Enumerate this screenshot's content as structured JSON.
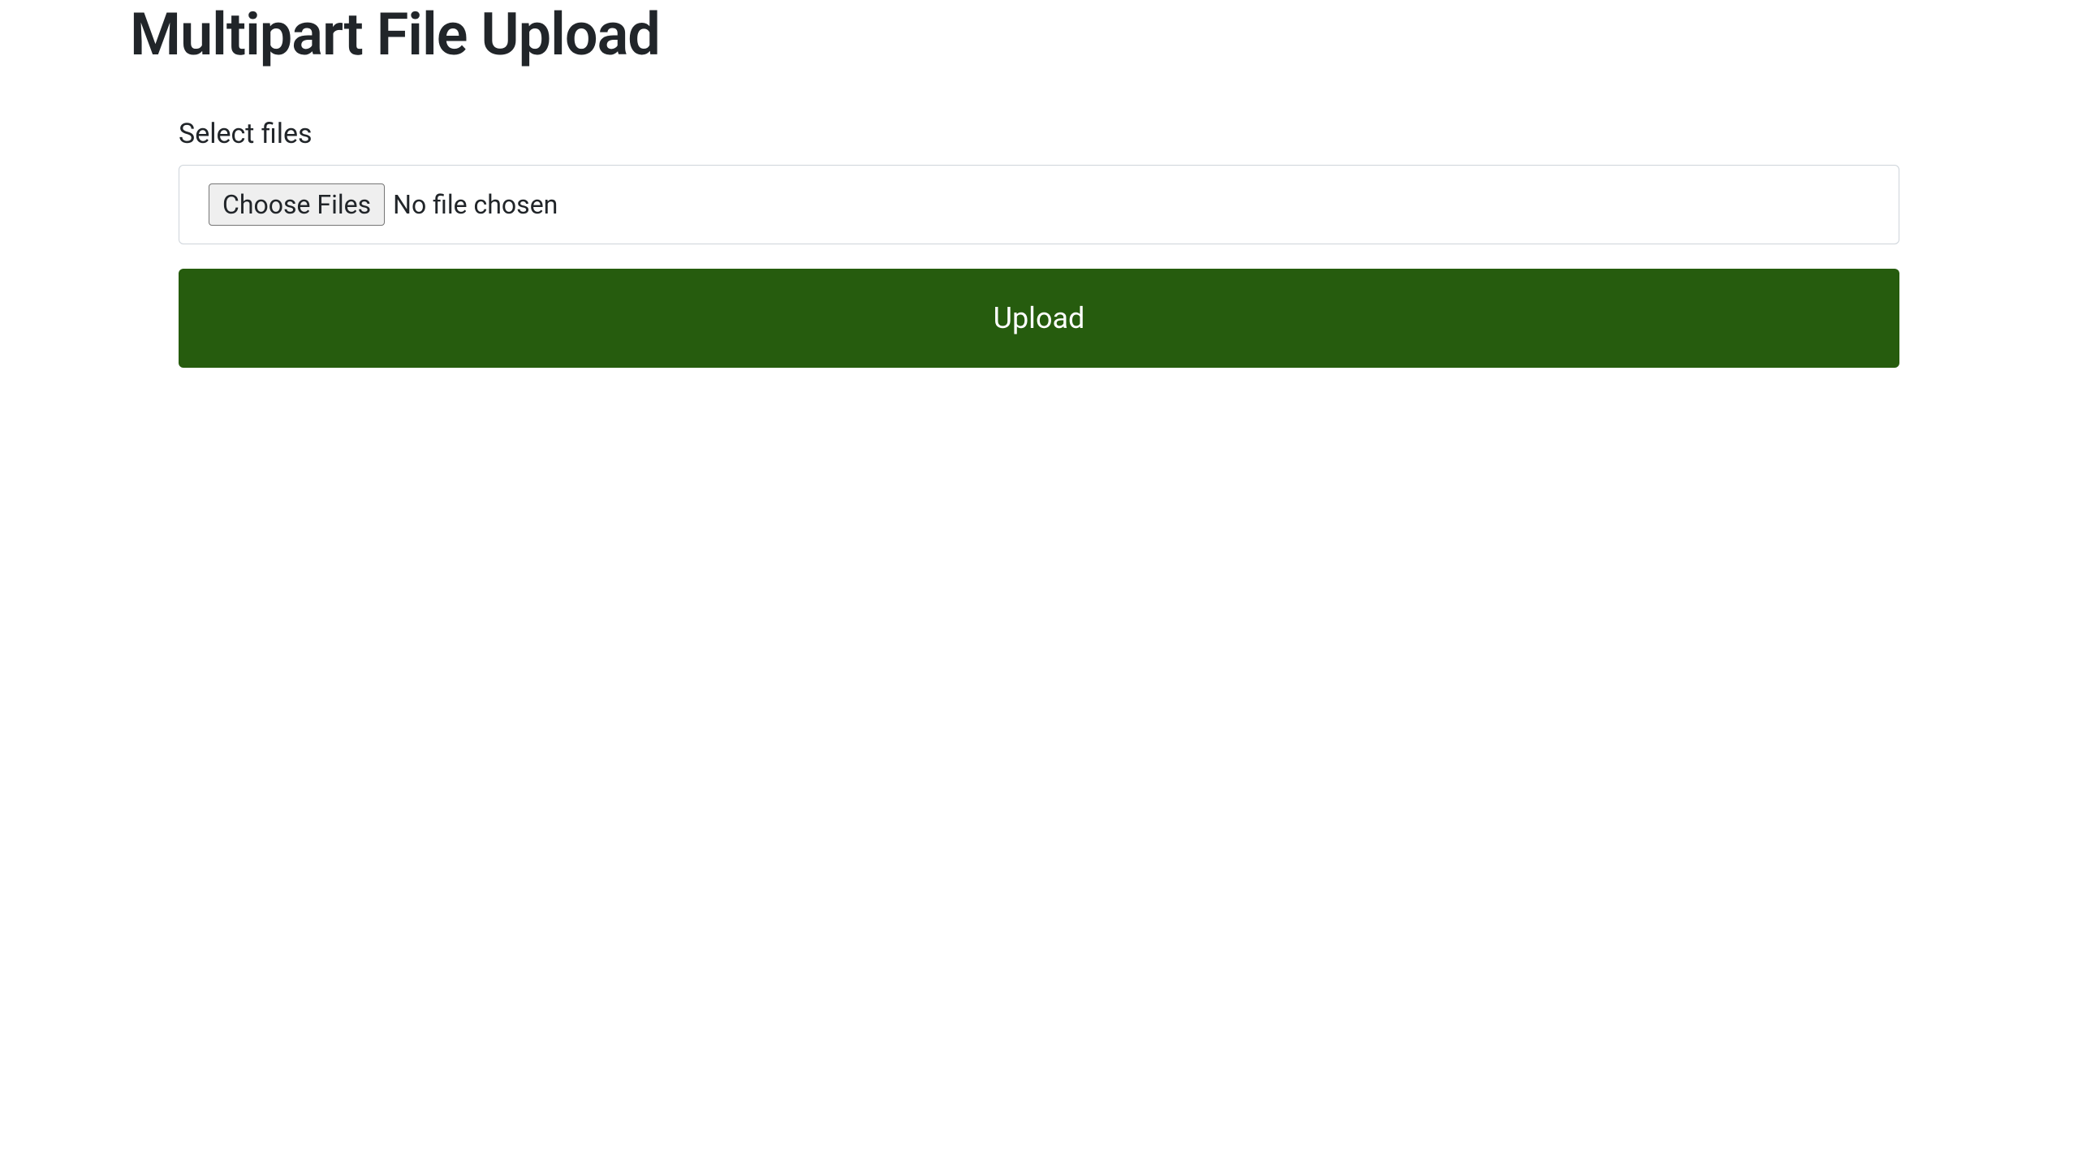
{
  "header": {
    "title": "Multipart File Upload"
  },
  "form": {
    "label": "Select files",
    "choose_button_label": "Choose Files",
    "file_status": "No file chosen",
    "upload_button_label": "Upload"
  },
  "colors": {
    "upload_button_bg": "#265c0e",
    "text_primary": "#212529",
    "border": "#ced4da"
  }
}
